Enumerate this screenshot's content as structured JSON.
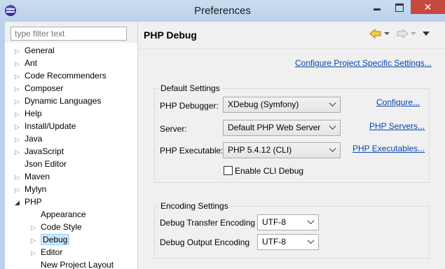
{
  "window": {
    "title": "Preferences",
    "close_glyph": "✕"
  },
  "sidebar": {
    "filter_placeholder": "type filter text",
    "items": [
      {
        "label": "General",
        "twisty": "▷"
      },
      {
        "label": "Ant",
        "twisty": "▷"
      },
      {
        "label": "Code Recommenders",
        "twisty": "▷"
      },
      {
        "label": "Composer",
        "twisty": "▷"
      },
      {
        "label": "Dynamic Languages",
        "twisty": "▷"
      },
      {
        "label": "Help",
        "twisty": "▷"
      },
      {
        "label": "Install/Update",
        "twisty": "▷"
      },
      {
        "label": "Java",
        "twisty": "▷"
      },
      {
        "label": "JavaScript",
        "twisty": "▷"
      },
      {
        "label": "Json Editor",
        "twisty": ""
      },
      {
        "label": "Maven",
        "twisty": "▷"
      },
      {
        "label": "Mylyn",
        "twisty": "▷"
      },
      {
        "label": "PHP",
        "twisty": "◢"
      },
      {
        "label": "Appearance",
        "twisty": ""
      },
      {
        "label": "Code Style",
        "twisty": "▷"
      },
      {
        "label": "Debug",
        "twisty": "▷"
      },
      {
        "label": "Editor",
        "twisty": "▷"
      },
      {
        "label": "New Project Layout",
        "twisty": ""
      }
    ]
  },
  "page": {
    "title": "PHP Debug",
    "configure_project_link": "Configure Project Specific Settings...",
    "default_settings": {
      "title": "Default Settings",
      "debugger_label": "PHP Debugger:",
      "debugger_value": "XDebug (Symfony)",
      "debugger_link": "Configure...",
      "server_label": "Server:",
      "server_value": "Default PHP Web Server",
      "server_link": "PHP Servers...",
      "executable_label": "PHP Executable:",
      "executable_value": "PHP 5.4.12 (CLI)",
      "executable_link": "PHP Executables...",
      "cli_debug_label": "Enable CLI Debug",
      "cli_debug_checked": false
    },
    "encoding_settings": {
      "title": "Encoding Settings",
      "transfer_label": "Debug Transfer Encoding",
      "transfer_value": "UTF-8",
      "output_label": "Debug Output Encoding",
      "output_value": "UTF-8"
    }
  },
  "colors": {
    "link": "#0645ad",
    "selection": "#cce8ff",
    "close": "#c7483e"
  }
}
